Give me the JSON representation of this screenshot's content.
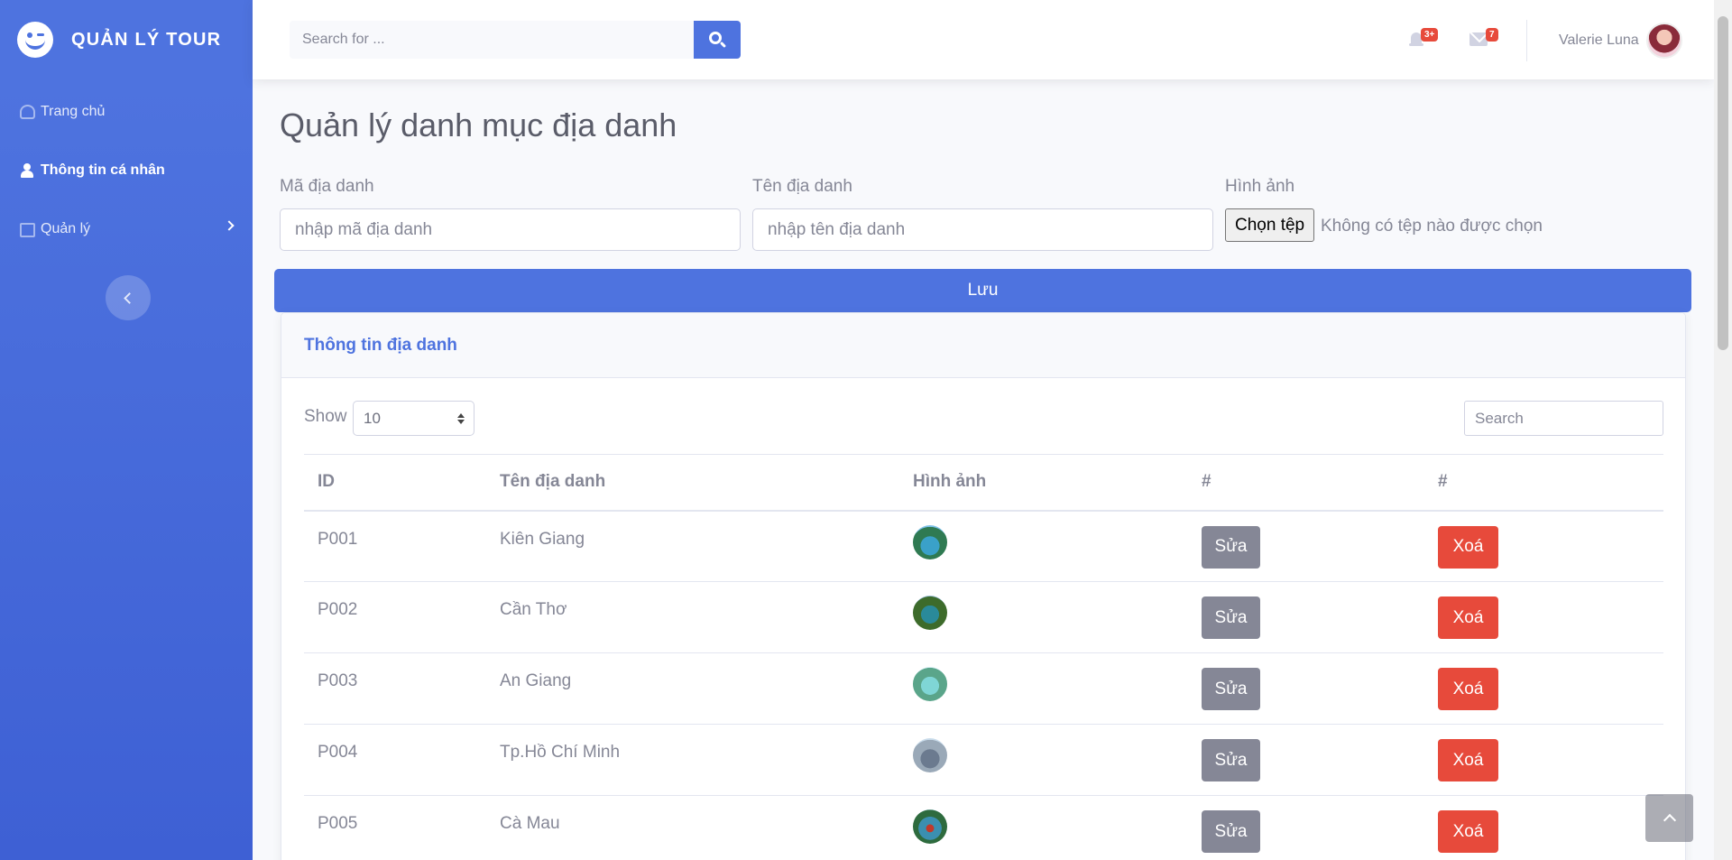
{
  "sidebar": {
    "brand": "QUẢN LÝ TOUR",
    "items": [
      {
        "label": "Trang chủ",
        "icon": "tachometer-icon"
      },
      {
        "label": "Thông tin cá nhân",
        "icon": "user-icon"
      },
      {
        "label": "Quản lý",
        "icon": "briefcase-icon"
      }
    ]
  },
  "topbar": {
    "search_placeholder": "Search for ...",
    "alerts_count": "3+",
    "messages_count": "7",
    "user_name": "Valerie Luna"
  },
  "main": {
    "title": "Quản lý danh mục địa danh",
    "form": {
      "code_label": "Mã địa danh",
      "code_placeholder": "nhập mã địa danh",
      "name_label": "Tên địa danh",
      "name_placeholder": "nhập tên địa danh",
      "image_label": "Hình ảnh",
      "file_button": "Chọn tệp",
      "file_status": "Không có tệp nào được chọn",
      "save_button": "Lưu"
    },
    "card": {
      "title": "Thông tin địa danh",
      "show_label": "Show",
      "show_value": "10",
      "search_placeholder": "Search",
      "columns": [
        "ID",
        "Tên địa danh",
        "Hình ảnh",
        "#",
        "#"
      ],
      "rows": [
        {
          "id": "P001",
          "name": "Kiên Giang",
          "edit": "Sửa",
          "delete": "Xoá"
        },
        {
          "id": "P002",
          "name": "Cần Thơ",
          "edit": "Sửa",
          "delete": "Xoá"
        },
        {
          "id": "P003",
          "name": "An Giang",
          "edit": "Sửa",
          "delete": "Xoá"
        },
        {
          "id": "P004",
          "name": "Tp.Hồ Chí Minh",
          "edit": "Sửa",
          "delete": "Xoá"
        },
        {
          "id": "P005",
          "name": "Cà Mau",
          "edit": "Sửa",
          "delete": "Xoá"
        }
      ]
    }
  },
  "colors": {
    "primary": "#4e73df",
    "danger": "#e74a3b",
    "secondary": "#858796"
  }
}
